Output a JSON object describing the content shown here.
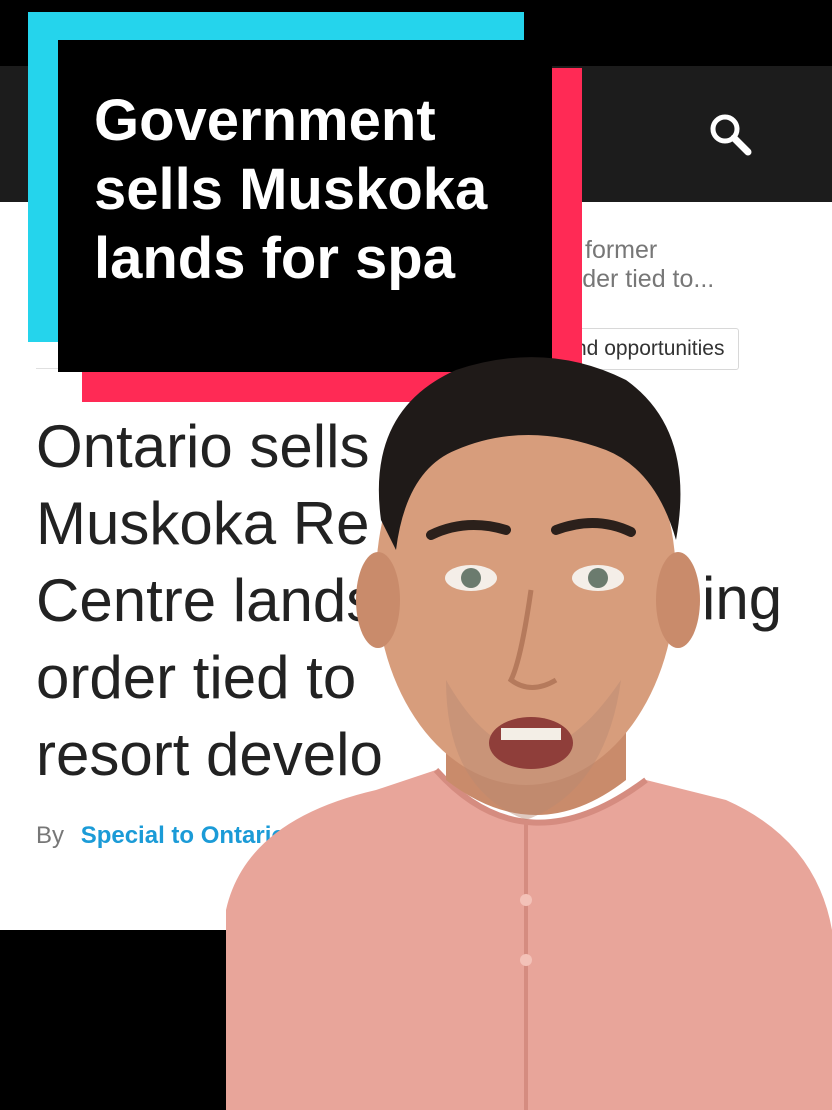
{
  "overlay": {
    "title_lines": [
      "Government",
      "sells Muskoka",
      "lands for spa"
    ]
  },
  "header": {
    "search_icon": "search-icon"
  },
  "article": {
    "related_snippet_lines": [
      "ls former",
      "order tied to..."
    ],
    "category_tag": "nd opportunities",
    "headline_lines": [
      "Ontario sells",
      "Muskoka Re",
      "Centre lands",
      "order tied to",
      "resort develo"
    ],
    "headline_right_fragment": "ing",
    "byline_prefix": "By",
    "byline_author": "Special to Ontario Cons"
  },
  "colors": {
    "overlay_cyan": "#25d4ec",
    "overlay_red": "#ff2a55",
    "author_link": "#1b9bd7"
  }
}
